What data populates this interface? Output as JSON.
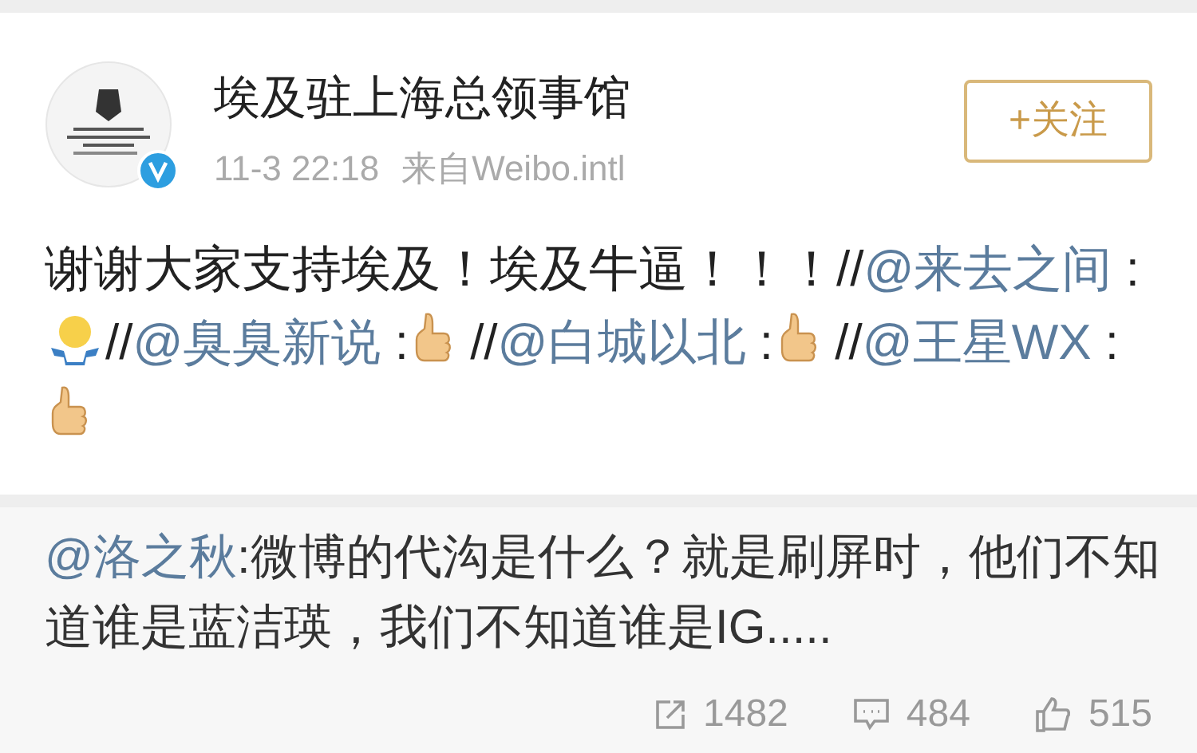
{
  "post": {
    "author": "埃及驻上海总领事馆",
    "verified": true,
    "time": "11-3 22:18",
    "source": "来自Weibo.intl",
    "follow_button": "+关注",
    "segments": [
      {
        "kind": "text",
        "text": "谢谢大家支持埃及！埃及牛逼！！！//"
      },
      {
        "kind": "mention",
        "text": "@来去之间"
      },
      {
        "kind": "text",
        "text": " :"
      },
      {
        "kind": "shrug"
      },
      {
        "kind": "text",
        "text": "//"
      },
      {
        "kind": "mention",
        "text": "@臭臭新说"
      },
      {
        "kind": "text",
        "text": " :"
      },
      {
        "kind": "thumbsup"
      },
      {
        "kind": "text",
        "text": " //"
      },
      {
        "kind": "mention",
        "text": "@白城以北"
      },
      {
        "kind": "text",
        "text": " :"
      },
      {
        "kind": "thumbsup"
      },
      {
        "kind": "text",
        "text": " //"
      },
      {
        "kind": "mention",
        "text": "@王星WX"
      },
      {
        "kind": "text",
        "text": " :"
      },
      {
        "kind": "thumbsup"
      }
    ]
  },
  "original": {
    "mention": "@洛之秋",
    "text": ":微博的代沟是什么？就是刷屏时，他们不知道谁是蓝洁瑛，我们不知道谁是IG.....",
    "actions": [
      {
        "kind": "share",
        "count": "1482"
      },
      {
        "kind": "comment",
        "count": "484"
      },
      {
        "kind": "like",
        "count": "515"
      }
    ]
  }
}
